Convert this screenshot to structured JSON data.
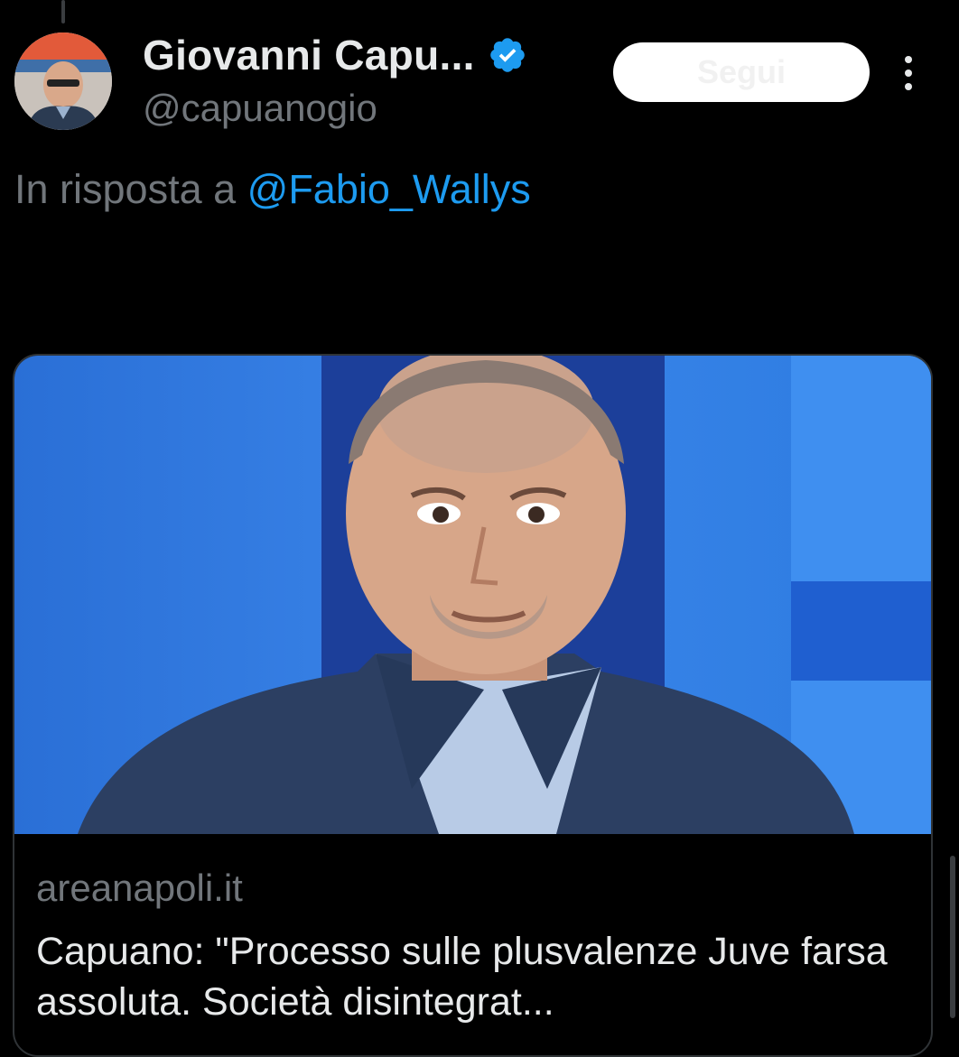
{
  "tweet": {
    "author": {
      "display_name": "Giovanni Capu...",
      "handle": "@capuanogio",
      "avatar_icon": "profile-photo",
      "verified_icon": "verified-badge-icon"
    },
    "follow_button": {
      "label": "Segui"
    },
    "more_icon": "more-vertical-icon",
    "reply_context": {
      "prefix": "In risposta a ",
      "mention": "@Fabio_Wallys"
    },
    "link_card": {
      "image_icon": "article-photo",
      "domain": "areanapoli.it",
      "title": "Capuano: \"Processo sulle plusvalenze Juve farsa assoluta. Società disintegrat..."
    }
  },
  "colors": {
    "background": "#000000",
    "text_primary": "#e7e9ea",
    "text_secondary": "#71767b",
    "accent": "#1d9bf0",
    "card_border": "#2f3336"
  }
}
